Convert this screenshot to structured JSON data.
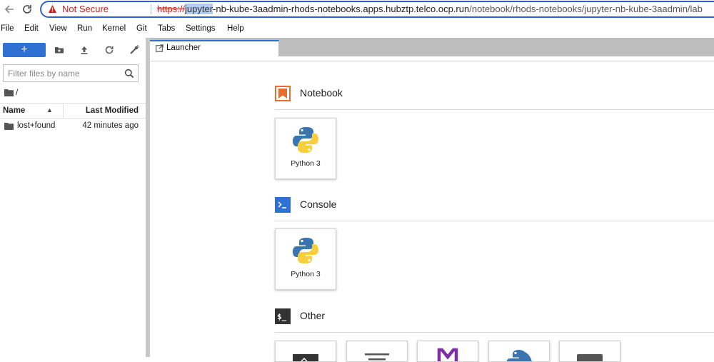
{
  "browser": {
    "back_icon": "back-arrow-icon",
    "reload_icon": "reload-icon",
    "security_label": "Not Secure",
    "url_scheme": "https://",
    "url_highlight": "jupyter",
    "url_host": "-nb-kube-3aadmin-rhods-notebooks.apps.hubztp.telco.ocp.run",
    "url_path": "/notebook/rhods-notebooks/jupyter-nb-kube-3aadmin/lab"
  },
  "menu": [
    "File",
    "Edit",
    "View",
    "Run",
    "Kernel",
    "Git",
    "Tabs",
    "Settings",
    "Help"
  ],
  "filebrowser": {
    "new_label": "+",
    "filter_placeholder": "Filter files by name",
    "breadcrumb": "/",
    "columns": {
      "name": "Name",
      "modified": "Last Modified"
    },
    "sort_indicator": "▲",
    "rows": [
      {
        "name": "lost+found",
        "modified": "42 minutes ago",
        "icon": "folder-icon"
      }
    ]
  },
  "tabs": [
    {
      "label": "Launcher",
      "icon": "launch-icon"
    }
  ],
  "launcher": {
    "sections": [
      {
        "title": "Notebook",
        "icon": "notebook-icon",
        "items": [
          {
            "label": "Python 3"
          }
        ]
      },
      {
        "title": "Console",
        "icon": "console-icon",
        "items": [
          {
            "label": "Python 3"
          }
        ]
      },
      {
        "title": "Other",
        "icon": "terminal-icon",
        "items": []
      }
    ]
  },
  "colors": {
    "accent": "#2f71d2",
    "notebook_orange": "#e46e2e",
    "warning_red": "#c5221f",
    "markdown_purple": "#7b2fa0"
  }
}
